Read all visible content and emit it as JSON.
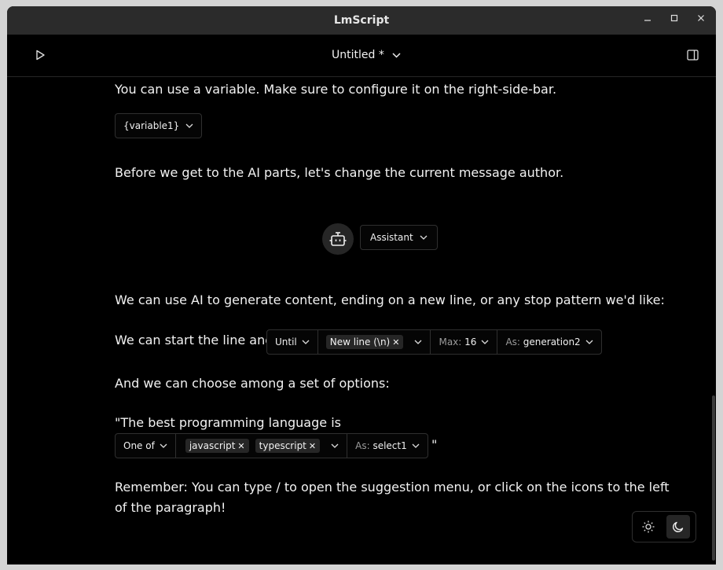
{
  "window": {
    "title": "LmScript",
    "controls": [
      "minimize",
      "maximize",
      "close"
    ]
  },
  "toolbar": {
    "doc_title": "Untitled *",
    "icons": {
      "run": "play-icon",
      "dropdown": "chevron-down-icon",
      "sidebar": "sidebar-toggle-icon"
    }
  },
  "editor": {
    "p1": "You can use a variable. Make sure to configure it on the right-side-bar.",
    "variable_chip": "{variable1}",
    "p2": "Before we get to the AI parts, let's change the current message author.",
    "author": {
      "role": "Assistant",
      "icon": "robot-icon"
    },
    "p3": "We can use AI to generate content, ending on a new line, or any stop pattern we'd like:",
    "generation": {
      "prefix": "We can start the line and",
      "mode": "Until",
      "stop_tag": "New line (\\n)",
      "max_label": "Max:",
      "max_value": "16",
      "as_label": "As:",
      "as_value": "generation2"
    },
    "p4": "And we can choose among a set of options:",
    "select": {
      "prefix": "\"The best programming language is",
      "mode": "One of",
      "options": [
        "javascript",
        "typescript"
      ],
      "as_label": "As:",
      "as_value": "select1",
      "suffix": "\""
    },
    "p5_line1": "Remember: You can type / to open the suggestion menu, or click on the icons to the left",
    "p5_line2": "of the paragraph!"
  },
  "theme_toggle": {
    "light_icon": "sun-icon",
    "dark_icon": "moon-icon",
    "active": "dark"
  }
}
